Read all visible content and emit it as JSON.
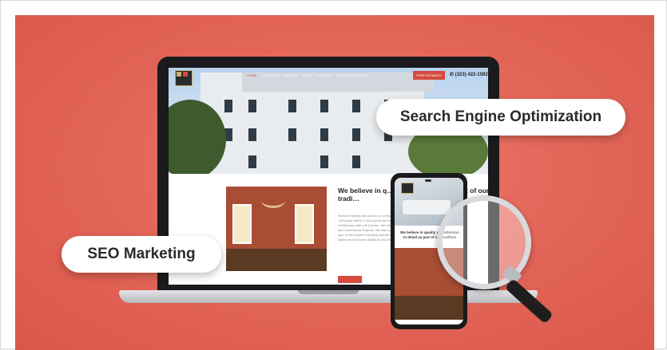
{
  "pills": {
    "search_engine_optimization": "Search Engine Optimization",
    "seo_marketing": "SEO Marketing"
  },
  "website": {
    "nav_links": [
      "HOME",
      "SERVICES",
      "GALLERY",
      "ABOUT",
      "CONTACT",
      "MEET THE OWNER"
    ],
    "estimate_button": "FREE ESTIMATE",
    "phone": "(323) 422-1592",
    "headline": "We believe in q… and attention to… part of our tradi…",
    "paragraph": "Roman Painting Services is a Licensed Painting Contractor with a C-33 License and a Lead-Safe Certification with a B License. We handle Residential and Commercial Projects. We also specialize in any type of Renovation including kitchen remodeling, bathroom and home additions and more."
  },
  "phone_screen": {
    "text": "We believe in quality and attention to detail as part of our tradition"
  },
  "colors": {
    "banner": "#e4675a",
    "accent": "#d64a3f",
    "pill_bg": "#ffffff"
  }
}
